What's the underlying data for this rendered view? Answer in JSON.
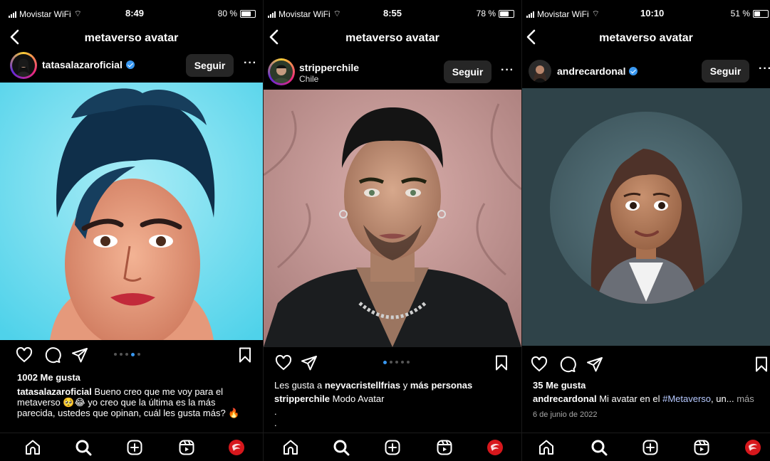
{
  "panels": [
    {
      "status": {
        "carrier": "Movistar WiFi",
        "time": "8:49",
        "battery": "80 %",
        "battery_level": 0.8
      },
      "nav": {
        "title": "metaverso avatar"
      },
      "post": {
        "username": "tatasalazaroficial",
        "verified": true,
        "follow_label": "Seguir",
        "likes": "1002 Me gusta",
        "caption_user": "tatasalazaroficial",
        "caption_text": "Bueno creo que me voy para el metaverso 🥺😂 yo creo que la última es la más parecida, ustedes que opinan, cuál les gusta más? 🔥",
        "carousel_dots": 5,
        "carousel_active": 4
      }
    },
    {
      "status": {
        "carrier": "Movistar WiFi",
        "time": "8:55",
        "battery": "78 %",
        "battery_level": 0.78
      },
      "nav": {
        "title": "metaverso avatar"
      },
      "post": {
        "username": "stripperchile",
        "location": "Chile",
        "follow_label": "Seguir",
        "liked_by_prefix": "Les gusta a",
        "liked_by_user": "neyvacristellfrias",
        "liked_by_join": "y",
        "liked_by_more": "más personas",
        "caption_user": "stripperchile",
        "caption_text": "Modo Avatar",
        "caption_line2": ".",
        "caption_line3": ".",
        "carousel_dots": 5,
        "carousel_active": 1
      }
    },
    {
      "status": {
        "carrier": "Movistar WiFi",
        "time": "10:10",
        "battery": "51 %",
        "battery_level": 0.51
      },
      "nav": {
        "title": "metaverso avatar"
      },
      "post": {
        "username": "andrecardonal",
        "verified": true,
        "follow_label": "Seguir",
        "likes": "35 Me gusta",
        "caption_user": "andrecardonal",
        "caption_text": "Mi avatar en el",
        "caption_hashtag": "#Metaverso",
        "caption_ellipsis": ", un...",
        "caption_more": "más",
        "date": "6 de junio de 2022"
      }
    }
  ],
  "icons": [
    "chevron-left-icon",
    "verified-badge-icon",
    "more-icon",
    "heart-icon",
    "comment-icon",
    "share-icon",
    "bookmark-icon",
    "home-icon",
    "search-icon",
    "create-icon",
    "reels-icon",
    "profile-icon"
  ]
}
